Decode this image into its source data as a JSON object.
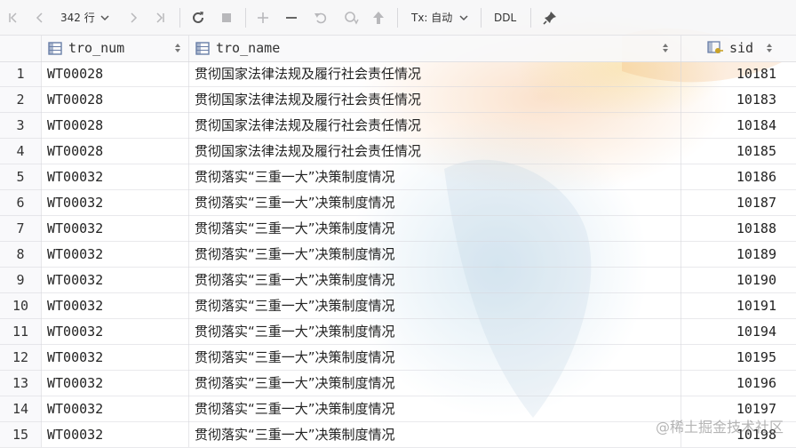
{
  "toolbar": {
    "row_count": "342 行",
    "tx_label": "Tx: 自动",
    "ddl_label": "DDL"
  },
  "table": {
    "columns": [
      {
        "name": "tro_num",
        "icon": "column-icon"
      },
      {
        "name": "tro_name",
        "icon": "column-icon"
      },
      {
        "name": "sid",
        "icon": "key-column-icon"
      }
    ],
    "rows": [
      {
        "n": "1",
        "tro_num": "WT00028",
        "tro_name": "贯彻国家法律法规及履行社会责任情况",
        "sid": "10181"
      },
      {
        "n": "2",
        "tro_num": "WT00028",
        "tro_name": "贯彻国家法律法规及履行社会责任情况",
        "sid": "10183"
      },
      {
        "n": "3",
        "tro_num": "WT00028",
        "tro_name": "贯彻国家法律法规及履行社会责任情况",
        "sid": "10184"
      },
      {
        "n": "4",
        "tro_num": "WT00028",
        "tro_name": "贯彻国家法律法规及履行社会责任情况",
        "sid": "10185"
      },
      {
        "n": "5",
        "tro_num": "WT00032",
        "tro_name": "贯彻落实“三重一大”决策制度情况",
        "sid": "10186"
      },
      {
        "n": "6",
        "tro_num": "WT00032",
        "tro_name": "贯彻落实“三重一大”决策制度情况",
        "sid": "10187"
      },
      {
        "n": "7",
        "tro_num": "WT00032",
        "tro_name": "贯彻落实“三重一大”决策制度情况",
        "sid": "10188"
      },
      {
        "n": "8",
        "tro_num": "WT00032",
        "tro_name": "贯彻落实“三重一大”决策制度情况",
        "sid": "10189"
      },
      {
        "n": "9",
        "tro_num": "WT00032",
        "tro_name": "贯彻落实“三重一大”决策制度情况",
        "sid": "10190"
      },
      {
        "n": "10",
        "tro_num": "WT00032",
        "tro_name": "贯彻落实“三重一大”决策制度情况",
        "sid": "10191"
      },
      {
        "n": "11",
        "tro_num": "WT00032",
        "tro_name": "贯彻落实“三重一大”决策制度情况",
        "sid": "10194"
      },
      {
        "n": "12",
        "tro_num": "WT00032",
        "tro_name": "贯彻落实“三重一大”决策制度情况",
        "sid": "10195"
      },
      {
        "n": "13",
        "tro_num": "WT00032",
        "tro_name": "贯彻落实“三重一大”决策制度情况",
        "sid": "10196"
      },
      {
        "n": "14",
        "tro_num": "WT00032",
        "tro_name": "贯彻落实“三重一大”决策制度情况",
        "sid": "10197"
      },
      {
        "n": "15",
        "tro_num": "WT00032",
        "tro_name": "贯彻落实“三重一大”决策制度情况",
        "sid": "10198"
      }
    ]
  },
  "watermark": "@稀土掘金技术社区",
  "colors": {
    "icon": "#6e6e73",
    "accent_key": "#c9a227",
    "column_icon": "#6a7fa8"
  }
}
